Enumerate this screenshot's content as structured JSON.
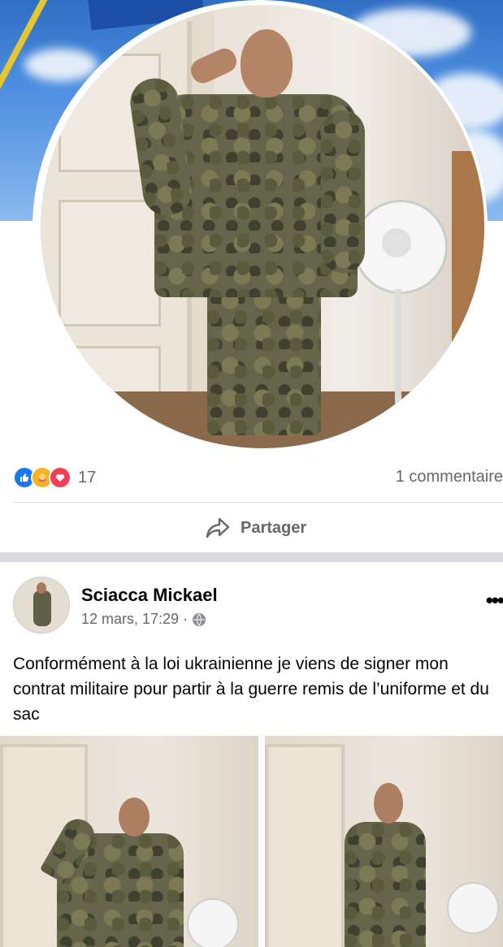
{
  "reactions": {
    "count": "17",
    "comments_label": "1 commentaire"
  },
  "actions": {
    "share_label": "Partager"
  },
  "post": {
    "author": "Sciacca Mickael",
    "timestamp": "12 mars, 17:29 ·",
    "more_label": "•••",
    "text": "Conformément à la loi ukrainienne je viens de signer mon contrat militaire pour partir à la guerre remis de l’uniforme et du sac"
  },
  "icons": {
    "like": "like-icon",
    "care": "care-icon",
    "love": "love-icon",
    "share": "share-arrow-icon",
    "audience": "globe-icon"
  },
  "colors": {
    "like_blue": "#1877f2",
    "care_yellow": "#f7b125",
    "love_red": "#f33e58",
    "secondary_text": "#65676b",
    "separator": "#d9dbe0"
  }
}
